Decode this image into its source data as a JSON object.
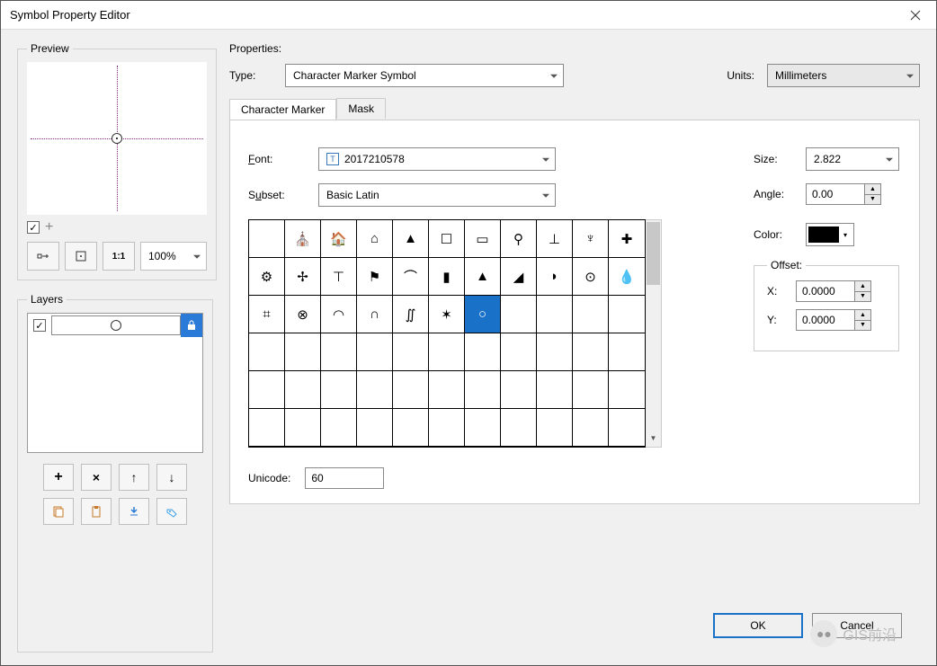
{
  "window": {
    "title": "Symbol Property Editor"
  },
  "preview": {
    "legend": "Preview",
    "zoom": "100%"
  },
  "layers": {
    "legend": "Layers"
  },
  "properties": {
    "header": "Properties:",
    "type_label": "Type:",
    "type_value": "Character Marker Symbol",
    "units_label": "Units:",
    "units_value": "Millimeters",
    "tabs": {
      "marker": "Character Marker",
      "mask": "Mask"
    },
    "font_label": "Font:",
    "font_value": "2017210578",
    "subset_label": "Subset:",
    "subset_value": "Basic Latin",
    "size_label": "Size:",
    "size_value": "2.822",
    "angle_label": "Angle:",
    "angle_value": "0.00",
    "color_label": "Color:",
    "offset": {
      "legend": "Offset:",
      "x_label": "X:",
      "x_value": "0.0000",
      "y_label": "Y:",
      "y_value": "0.0000"
    },
    "unicode_label": "Unicode:",
    "unicode_value": "60",
    "glyphs": [
      "",
      "⛪",
      "🏠",
      "⌂",
      "▲",
      "☐",
      "▭",
      "⚲",
      "⊥",
      "♆",
      "✚",
      "⚙",
      "✢",
      "⊤",
      "⚑",
      "⌒",
      "▮",
      "▲",
      "◢",
      "◗",
      "⊙",
      "💧",
      "⌗",
      "⊗",
      "◠",
      "∩",
      "∬",
      "✶",
      "○",
      "",
      "",
      "",
      "",
      "",
      "",
      "",
      "",
      "",
      "",
      "",
      "",
      "",
      "",
      "",
      "",
      "",
      "",
      "",
      "",
      "",
      "",
      "",
      "",
      "",
      "",
      "",
      "",
      "",
      "",
      "",
      "",
      "",
      "",
      "",
      "",
      ""
    ],
    "selected_glyph_index": 28
  },
  "footer": {
    "ok": "OK",
    "cancel": "Cancel"
  },
  "watermark": "GIS前沿"
}
